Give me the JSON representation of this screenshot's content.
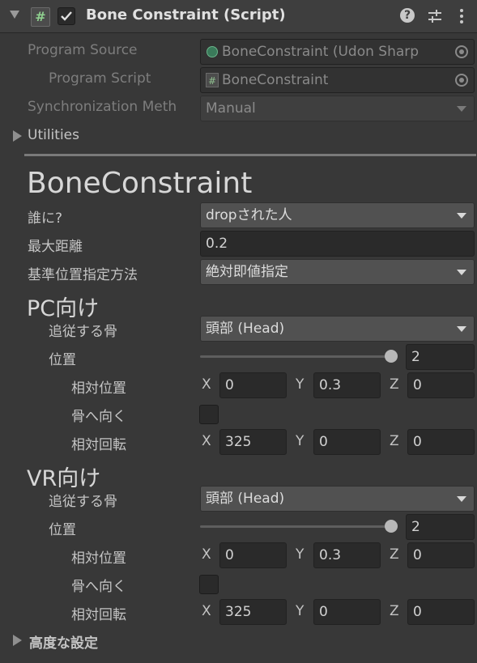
{
  "header": {
    "title": "Bone Constraint (Script)",
    "enabled": true
  },
  "program": {
    "source_label": "Program Source",
    "source_value": "BoneConstraint (Udon Sharp",
    "script_label": "Program Script",
    "script_value": "BoneConstraint",
    "sync_label": "Synchronization Meth",
    "sync_value": "Manual"
  },
  "utilities": {
    "label": "Utilities"
  },
  "component_title": "BoneConstraint",
  "fields": {
    "who_label": "誰に?",
    "who_value": "dropされた人",
    "maxdist_label": "最大距離",
    "maxdist_value": "0.2",
    "method_label": "基準位置指定方法",
    "method_value": "絶対即値指定"
  },
  "pc": {
    "heading": "PC向け",
    "bone_label": "追従する骨",
    "bone_value": "頭部 (Head)",
    "position_label": "位置",
    "position_value": "2",
    "position_fraction": 1.0,
    "relpos_label": "相対位置",
    "relpos": {
      "x": "0",
      "y": "0.3",
      "z": "0"
    },
    "face_label": "骨へ向く",
    "face_checked": false,
    "relrot_label": "相対回転",
    "relrot": {
      "x": "325",
      "y": "0",
      "z": "0"
    }
  },
  "vr": {
    "heading": "VR向け",
    "bone_label": "追従する骨",
    "bone_value": "頭部 (Head)",
    "position_label": "位置",
    "position_value": "2",
    "position_fraction": 1.0,
    "relpos_label": "相対位置",
    "relpos": {
      "x": "0",
      "y": "0.3",
      "z": "0"
    },
    "face_label": "骨へ向く",
    "face_checked": false,
    "relrot_label": "相対回転",
    "relrot": {
      "x": "325",
      "y": "0",
      "z": "0"
    }
  },
  "axis": {
    "x": "X",
    "y": "Y",
    "z": "Z"
  },
  "advanced": {
    "label": "高度な設定"
  },
  "colors": {
    "background": "#383838",
    "field": "#2a2a2a",
    "dropdown": "#515151"
  }
}
